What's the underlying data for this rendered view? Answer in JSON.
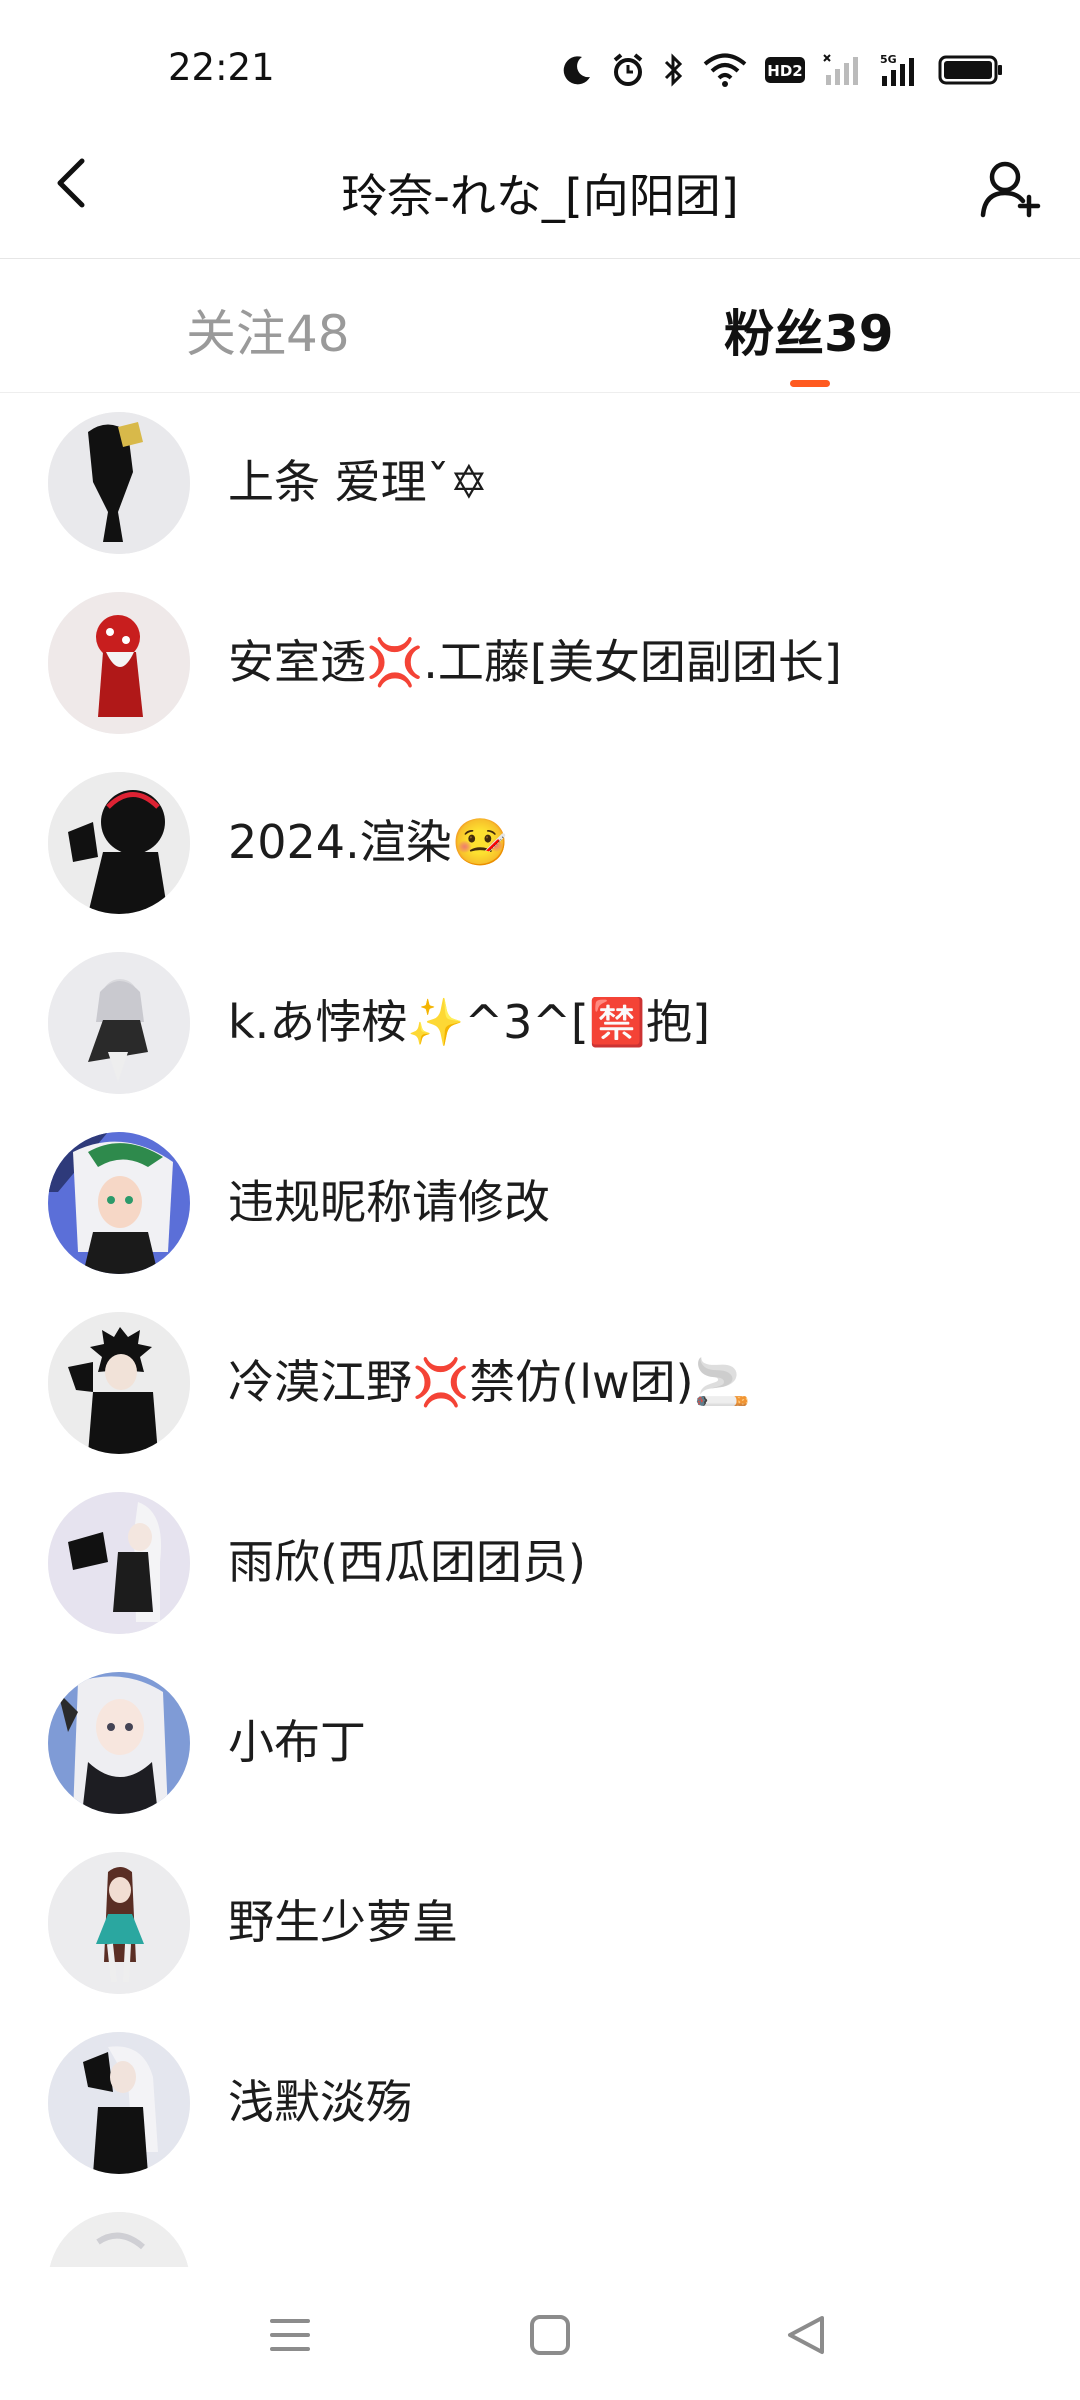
{
  "status_bar": {
    "time": "22:21",
    "icons": [
      "moon-icon",
      "alarm-icon",
      "bluetooth-icon",
      "wifi-icon",
      "hd-icon",
      "signal-icon",
      "5g-signal-icon",
      "battery-icon"
    ],
    "hd_text": "HD2",
    "net_text": "5G"
  },
  "header": {
    "title": "玲奈-れな_[向阳团]",
    "back_icon": "chevron-left-icon",
    "add_icon": "add-user-icon"
  },
  "tabs": {
    "following_label": "关注",
    "following_count": "48",
    "fans_label": "粉丝",
    "fans_count": "39",
    "active": "fans",
    "accent_color": "#ff5a1f"
  },
  "fans": [
    {
      "name": "上条  爱理ˇ✡",
      "avatar_bg": "#e9e9ec"
    },
    {
      "name": "安室透💢.工藤[美女团副团长]",
      "avatar_bg": "#efe9e9"
    },
    {
      "name": "2024.渲染🤒",
      "avatar_bg": "#ececec"
    },
    {
      "name": "k.あ悖桉✨^3^[🈲抱]",
      "avatar_bg": "#ebebee"
    },
    {
      "name": "违规昵称请修改",
      "avatar_bg": "#5b6fd8"
    },
    {
      "name": "冷漠江野💢禁仿(lw团)🚬",
      "avatar_bg": "#ececec"
    },
    {
      "name": "雨欣(西瓜团团员)",
      "avatar_bg": "#e6e3ef"
    },
    {
      "name": "小布丁",
      "avatar_bg": "#7f9bd6"
    },
    {
      "name": "野生少萝皇",
      "avatar_bg": "#ececee"
    },
    {
      "name": "浅默淡殇",
      "avatar_bg": "#e4e6ee"
    },
    {
      "name": "",
      "avatar_bg": "#eeeeee"
    }
  ],
  "nav_bar": {
    "icons": [
      "menu-icon",
      "home-square-icon",
      "back-triangle-icon"
    ]
  }
}
